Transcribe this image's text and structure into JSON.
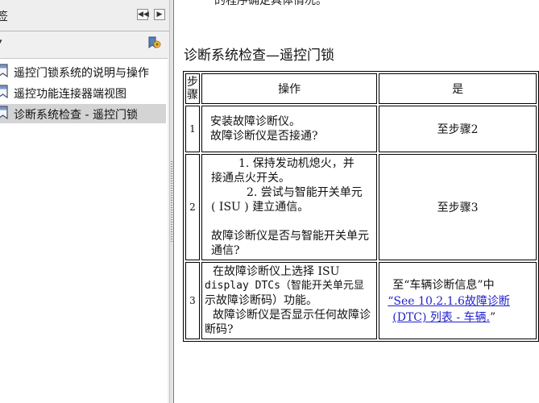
{
  "nav": {
    "title": "签",
    "collapse_symbol": "◀◀",
    "expand_symbol": "▶",
    "menu_symbol": "▾",
    "items": [
      {
        "label": "遥控门锁系统的说明与操作",
        "selected": false
      },
      {
        "label": "遥控功能连接器端视图",
        "selected": false
      },
      {
        "label": "诊断系统检查 - 遥控门锁",
        "selected": true
      }
    ],
    "icons": [
      "bookmark-icon"
    ]
  },
  "document": {
    "previous_text": "的程序确定具体情况。",
    "section_title": "诊断系统检查—遥控门锁",
    "table": {
      "headers": {
        "step": "步骤",
        "action": "操作",
        "yes": "是"
      },
      "rows": [
        {
          "step": "1",
          "action_lines": [
            "安装故障诊断仪。",
            "故障诊断仪是否接通?"
          ],
          "yes": "至步骤2"
        },
        {
          "step": "2",
          "action_lines": [
            "1. 保持发动机熄火，并",
            "接通点火开关。",
            "2. 尝试与智能开关单元",
            "( ISU ) 建立通信。",
            "",
            "故障诊断仪是否与智能开关单元",
            "通信?"
          ],
          "yes": "至步骤3"
        },
        {
          "step": "3",
          "action_lines": [
            "在故障诊断仪上选择 ISU",
            "display DTCs（智能开关单元显",
            "示故障诊断码）功能。",
            "故障诊断仪是否显示任何故障诊",
            "断码?"
          ],
          "yes_prefix": "至“车辆诊断信息”中",
          "yes_link": "“See 10.2.1.6故障诊断",
          "yes_link2": "(DTC) 列表 - 车辆.",
          "yes_suffix": "”"
        }
      ]
    }
  },
  "colors": {
    "link": "#2222cc",
    "selected": "#d4d4d4",
    "pane": "#f0f0f0"
  }
}
